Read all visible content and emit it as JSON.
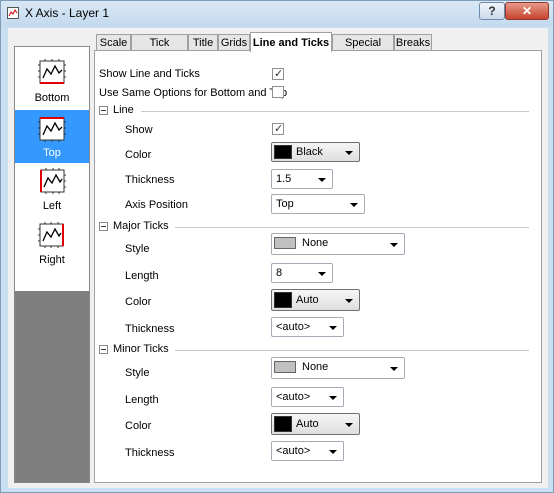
{
  "window": {
    "title": "X Axis - Layer 1",
    "help_label": "?",
    "close_label": "✕"
  },
  "sidebar": {
    "items": [
      {
        "label": "Bottom",
        "selected": false
      },
      {
        "label": "Top",
        "selected": true
      },
      {
        "label": "Left",
        "selected": false
      },
      {
        "label": "Right",
        "selected": false
      }
    ]
  },
  "tabs": [
    {
      "label": "Scale"
    },
    {
      "label": "Tick Labels"
    },
    {
      "label": "Title"
    },
    {
      "label": "Grids"
    },
    {
      "label": "Line and Ticks",
      "active": true
    },
    {
      "label": "Special Ticks"
    },
    {
      "label": "Breaks"
    }
  ],
  "options": {
    "show_line_ticks_label": "Show Line and Ticks",
    "show_line_ticks_checked": true,
    "same_options_label": "Use Same Options for Bottom and Top",
    "same_options_checked": false
  },
  "line": {
    "group_title": "Line",
    "show_label": "Show",
    "show_checked": true,
    "color_label": "Color",
    "color_value": "Black",
    "color_hex": "#000000",
    "thickness_label": "Thickness",
    "thickness_value": "1.5",
    "axis_position_label": "Axis Position",
    "axis_position_value": "Top"
  },
  "major_ticks": {
    "group_title": "Major Ticks",
    "style_label": "Style",
    "style_value": "None",
    "length_label": "Length",
    "length_value": "8",
    "color_label": "Color",
    "color_value": "Auto",
    "color_hex": "#000000",
    "thickness_label": "Thickness",
    "thickness_value": "<auto>"
  },
  "minor_ticks": {
    "group_title": "Minor Ticks",
    "style_label": "Style",
    "style_value": "None",
    "length_label": "Length",
    "length_value": "<auto>",
    "color_label": "Color",
    "color_value": "Auto",
    "color_hex": "#000000",
    "thickness_label": "Thickness",
    "thickness_value": "<auto>"
  },
  "colors": {
    "selection": "#3399ff",
    "style_swatch": "#c0c0c0"
  }
}
